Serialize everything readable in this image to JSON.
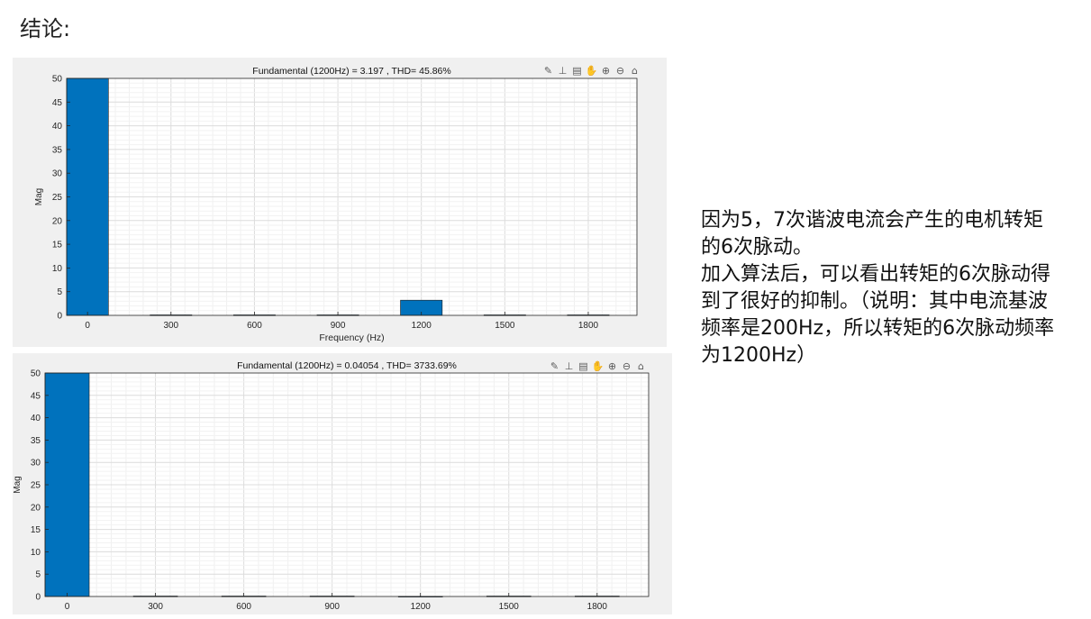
{
  "slide": {
    "title": "结论:",
    "notes": [
      "因为5，7次谐波电流会产生的电机转矩的6次脉动。",
      "加入算法后，可以看出转矩的6次脉动得到了很好的抑制。（说明：其中电流基波频率是200Hz，所以转矩的6次脉动频率为1200Hz）"
    ]
  },
  "colors": {
    "bar": "#0072bd",
    "grid": "#e3e3e3",
    "panel_bg": "#f0f0f0",
    "plot_bg": "#ffffff"
  },
  "toolbar_icons": [
    "brush-icon",
    "datatip-icon",
    "legend-icon",
    "pan-icon",
    "zoom-in-icon",
    "zoom-out-icon",
    "home-icon"
  ],
  "chart_data": [
    {
      "type": "bar",
      "title": "Fundamental (1200Hz) = 3.197 , THD= 45.86%",
      "xlabel": "Frequency (Hz)",
      "ylabel": "Mag",
      "xticks": [
        0,
        300,
        600,
        900,
        1200,
        1500,
        1800
      ],
      "yticks": [
        0,
        5,
        10,
        15,
        20,
        25,
        30,
        35,
        40,
        45,
        50
      ],
      "xlim": [
        -75,
        1975
      ],
      "ylim": [
        0,
        50
      ],
      "bar_width": 150,
      "grid": true,
      "x": [
        0,
        300,
        600,
        900,
        1200,
        1500,
        1800
      ],
      "values": [
        50,
        0.1,
        0.1,
        0.1,
        3.197,
        0.1,
        0.1
      ]
    },
    {
      "type": "bar",
      "title": "Fundamental (1200Hz) = 0.04054 , THD= 3733.69%",
      "xlabel": "",
      "ylabel": "Mag",
      "xticks": [
        0,
        300,
        600,
        900,
        1200,
        1500,
        1800
      ],
      "yticks": [
        0,
        5,
        10,
        15,
        20,
        25,
        30,
        35,
        40,
        45,
        50
      ],
      "xlim": [
        -75,
        1975
      ],
      "ylim": [
        0,
        50
      ],
      "bar_width": 150,
      "grid": true,
      "x": [
        0,
        300,
        600,
        900,
        1200,
        1500,
        1800
      ],
      "values": [
        50,
        0.1,
        0.1,
        0.1,
        0.04054,
        0.1,
        0.1
      ]
    }
  ]
}
